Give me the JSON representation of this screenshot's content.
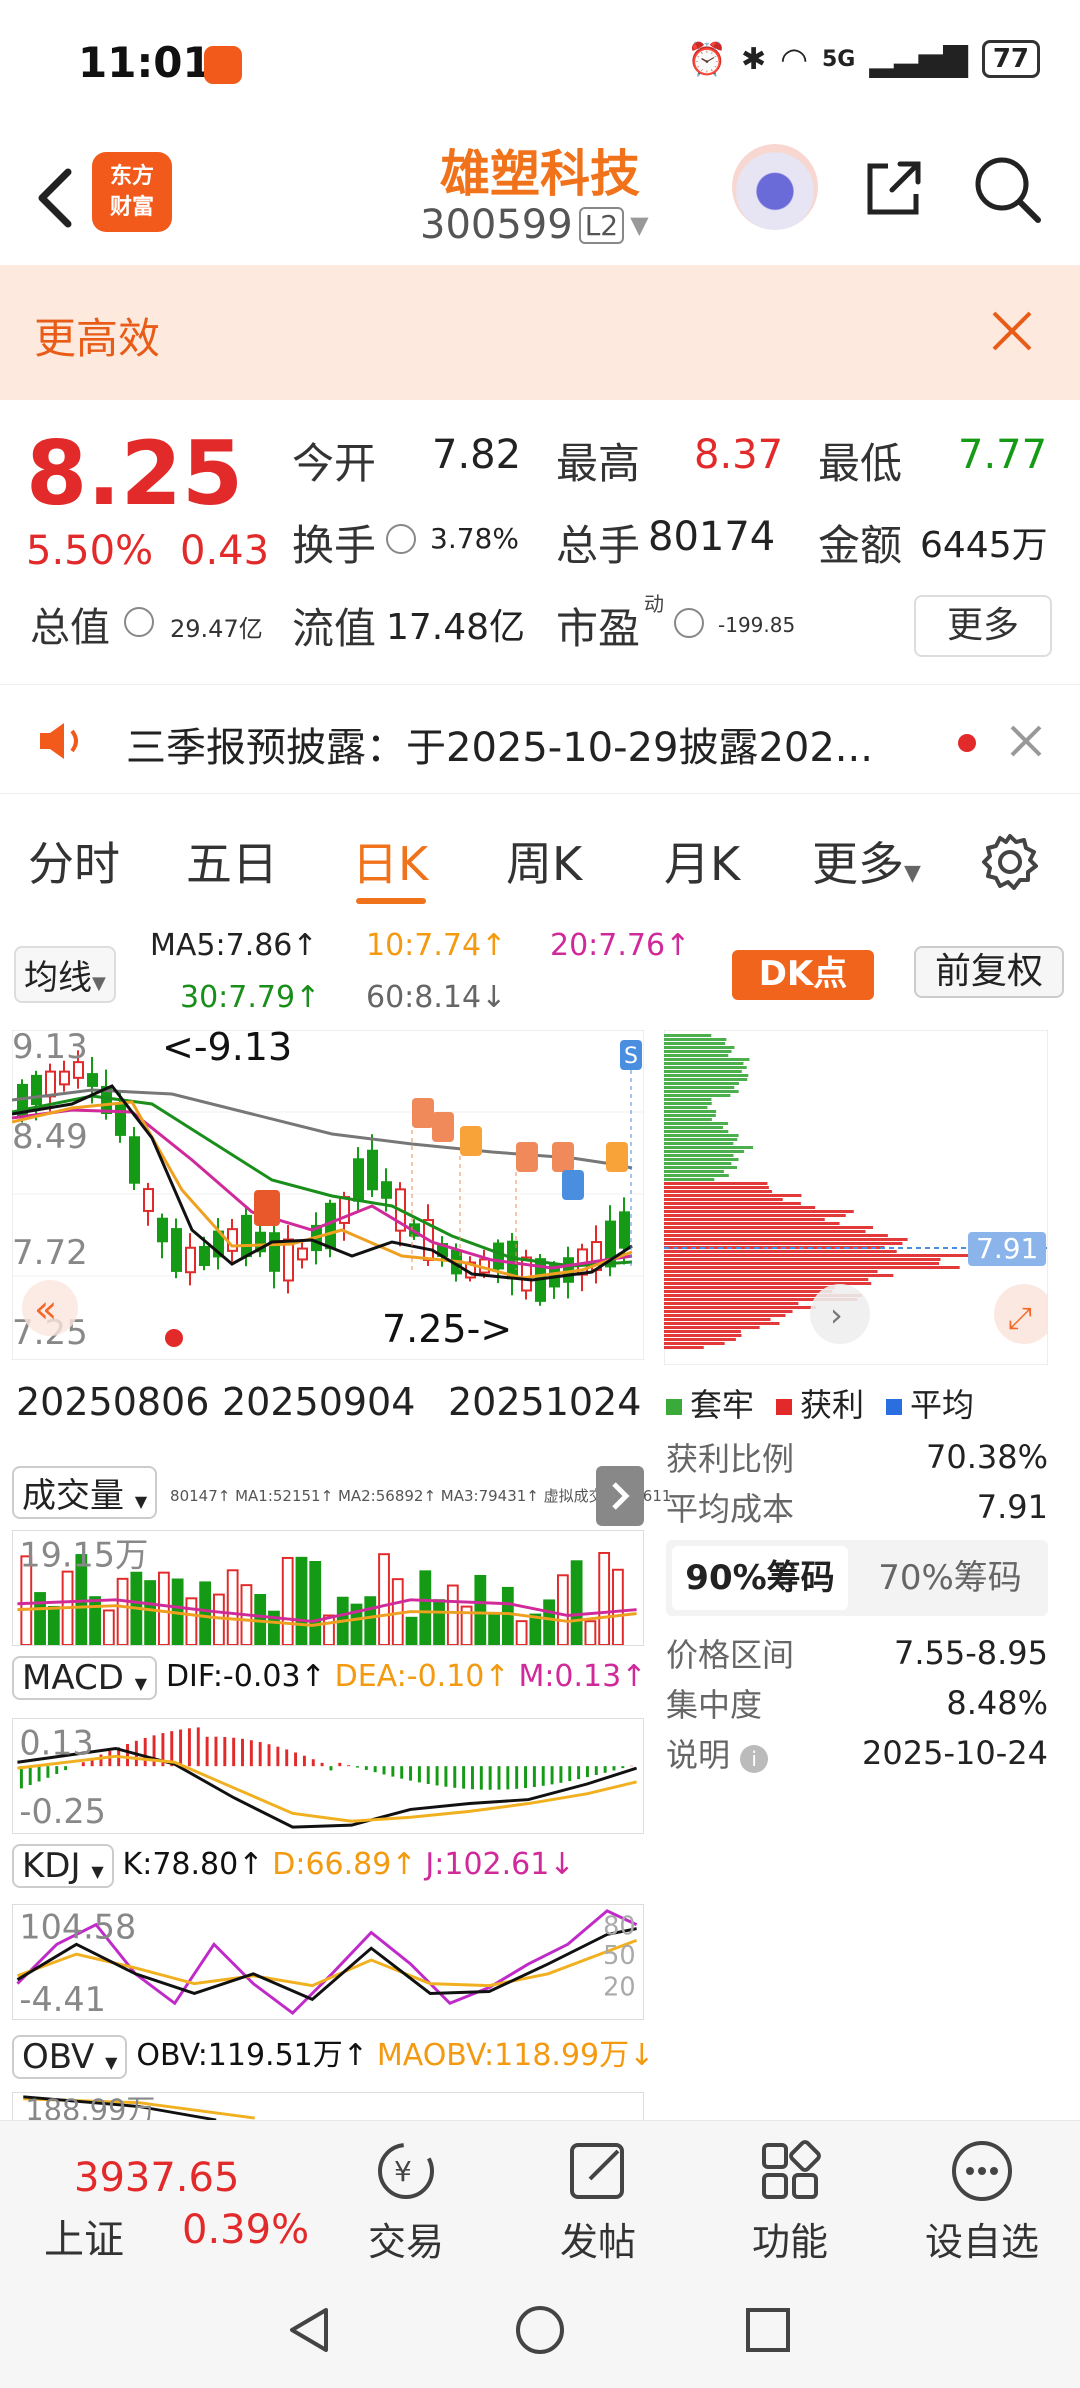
{
  "status_bar": {
    "time": "11:01",
    "battery": "77",
    "network": "5G"
  },
  "header": {
    "logo_line1": "东方",
    "logo_line2": "财富",
    "stock_name": "雄塑科技",
    "stock_code": "300599",
    "level_badge": "L2"
  },
  "promo": {
    "text": "更高效"
  },
  "quote": {
    "price": "8.25",
    "change_pct": "5.50%",
    "change_val": "0.43",
    "open_label": "今开",
    "open": "7.82",
    "high_label": "最高",
    "high": "8.37",
    "low_label": "最低",
    "low": "7.77",
    "turnover_label": "换手",
    "turnover": "3.78%",
    "volume_label": "总手",
    "volume": "80174",
    "amount_label": "金额",
    "amount": "6445万",
    "mktcap_label": "总值",
    "mktcap": "29.47亿",
    "float_label": "流值",
    "float": "17.48亿",
    "pe_label": "市盈",
    "pe_sup": "动",
    "pe": "-199.85",
    "more": "更多"
  },
  "announcement": {
    "text": "三季报预披露：于2025-10-29披露202..."
  },
  "tabs": [
    "分时",
    "五日",
    "日K",
    "周K",
    "月K",
    "更多"
  ],
  "active_tab": "日K",
  "ma": {
    "selector": "均线",
    "ma5": "MA5:7.86↑",
    "ma10": "10:7.74↑",
    "ma20": "20:7.76↑",
    "ma30": "30:7.79↑",
    "ma60": "60:8.14↓",
    "dk": "DK点",
    "fuquan": "前复权"
  },
  "kchart": {
    "y_labels": [
      "9.13",
      "8.49",
      "7.72",
      "7.25"
    ],
    "high_marker": "<-9.13",
    "low_marker": "7.25->",
    "dates": [
      "20250806",
      "20250904",
      "20251024"
    ]
  },
  "chip": {
    "price_marker": "7.91",
    "legend": [
      "套牢",
      "获利",
      "平均"
    ],
    "profit_ratio_label": "获利比例",
    "profit_ratio": "70.38%",
    "avg_cost_label": "平均成本",
    "avg_cost": "7.91",
    "tab_90": "90%筹码",
    "tab_70": "70%筹码",
    "range_label": "价格区间",
    "range": "7.55-8.95",
    "concentration_label": "集中度",
    "concentration": "8.48%",
    "note_label": "说明",
    "note_date": "2025-10-24"
  },
  "volume": {
    "selector": "成交量",
    "line": "80147↑ MA1:52151↑ MA2:56892↑ MA3:79431↑ 虚拟成交量:99611",
    "y_label": "19.15万"
  },
  "macd": {
    "selector": "MACD",
    "dif": "DIF:-0.03↑",
    "dea": "DEA:-0.10↑",
    "m": "M:0.13↑",
    "y_top": "0.13",
    "y_bottom": "-0.25"
  },
  "kdj": {
    "selector": "KDJ",
    "k": "K:78.80↑",
    "d": "D:66.89↑",
    "j": "J:102.61↓",
    "y_top": "104.58",
    "y_bottom": "-4.41",
    "r80": "80",
    "r50": "50",
    "r20": "20"
  },
  "obv": {
    "selector": "OBV",
    "obv": "OBV:119.51万↑",
    "maobv": "MAOBV:118.99万↓",
    "y_top": "188.99万"
  },
  "bottom_bar": {
    "index_value": "3937.65",
    "index_name": "上证",
    "index_pct": "0.39%",
    "nav": [
      "交易",
      "发帖",
      "功能",
      "设自选"
    ]
  },
  "colors": {
    "accent": "#f0731c",
    "up": "#e22a2a",
    "down": "#159a15"
  }
}
